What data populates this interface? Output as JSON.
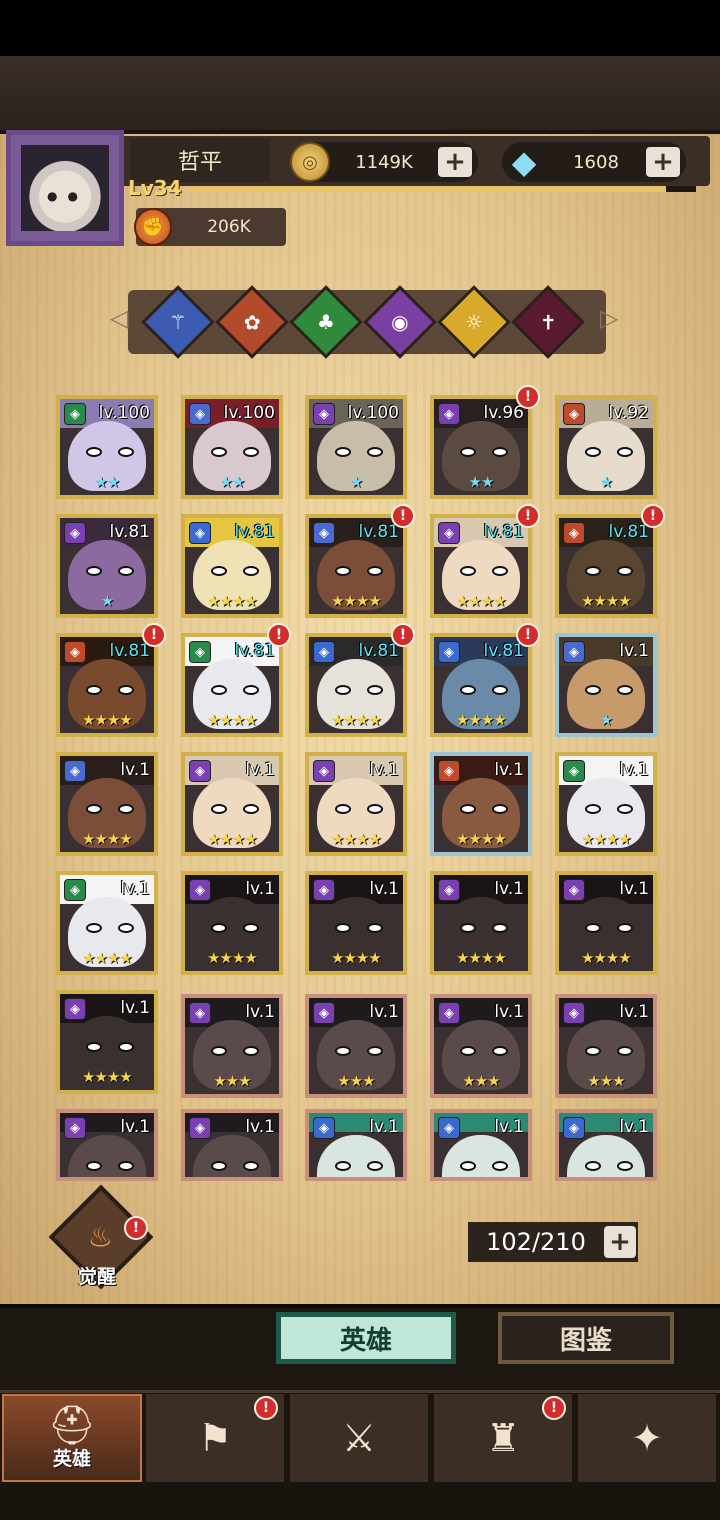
{
  "player": {
    "name": "哲平",
    "level_label": "Lv34",
    "xp_fraction": 0.94,
    "power": "206K"
  },
  "currency": {
    "gold": "1149K",
    "gems": "1608",
    "add_symbol": "+"
  },
  "filters": [
    {
      "icon": "staff-emblem-icon",
      "color": "#3d5bb0",
      "glyph": "⚚"
    },
    {
      "icon": "rose-emblem-icon",
      "color": "#b24a2c",
      "glyph": "✿"
    },
    {
      "icon": "clover-emblem-icon",
      "color": "#2f8a3c",
      "glyph": "♣"
    },
    {
      "icon": "eye-emblem-icon",
      "color": "#7a3fa0",
      "glyph": "◉"
    },
    {
      "icon": "sun-emblem-icon",
      "color": "#d8a92a",
      "glyph": "☼"
    },
    {
      "icon": "dagger-emblem-icon",
      "color": "#5a1a30",
      "glyph": "✝"
    }
  ],
  "heroes": [
    {
      "level": "lv.100",
      "stars": "★★",
      "class": "tank",
      "cyan": false,
      "blue_stars": true,
      "tier": "gold",
      "alert": false,
      "skin": "#cfc6e8",
      "hair": "#8a7bb0"
    },
    {
      "level": "lv.100",
      "stars": "★★",
      "class": "mage",
      "cyan": false,
      "blue_stars": true,
      "tier": "gold",
      "alert": false,
      "skin": "#d9c9cf",
      "hair": "#7a1f2a"
    },
    {
      "level": "lv.100",
      "stars": "★",
      "class": "support",
      "cyan": false,
      "blue_stars": true,
      "tier": "gold",
      "alert": false,
      "skin": "#c8bda8",
      "hair": "#6a6458"
    },
    {
      "level": "lv.96",
      "stars": "★★",
      "class": "assassin",
      "cyan": false,
      "blue_stars": true,
      "tier": "gold",
      "alert": true,
      "skin": "#5a4a40",
      "hair": "#2a2020"
    },
    {
      "level": "lv.92",
      "stars": "★",
      "class": "warrior",
      "cyan": false,
      "blue_stars": true,
      "tier": "gold",
      "alert": false,
      "skin": "#e6dccb",
      "hair": "#b9ad98"
    },
    {
      "level": "lv.81",
      "stars": "★",
      "class": "support",
      "cyan": false,
      "blue_stars": true,
      "tier": "gold",
      "alert": false,
      "skin": "#8a6aa0",
      "hair": "#3a2a3a"
    },
    {
      "level": "lv.81",
      "stars": "★★★★",
      "class": "ranger",
      "cyan": true,
      "blue_stars": false,
      "tier": "gold",
      "alert": false,
      "skin": "#efe2b4",
      "hair": "#e6c640"
    },
    {
      "level": "lv.81",
      "stars": "★★★★",
      "class": "mage",
      "cyan": true,
      "blue_stars": false,
      "tier": "gold",
      "alert": true,
      "skin": "#7a4e38",
      "hair": "#2a1e1a"
    },
    {
      "level": "lv.81",
      "stars": "★★★★",
      "class": "assassin",
      "cyan": true,
      "blue_stars": false,
      "tier": "gold",
      "alert": true,
      "skin": "#efd9c0",
      "hair": "#d8c8b0"
    },
    {
      "level": "lv.81",
      "stars": "★★★★",
      "class": "gunner",
      "cyan": true,
      "blue_stars": false,
      "tier": "gold",
      "alert": true,
      "skin": "#5a4630",
      "hair": "#2a2218"
    },
    {
      "level": "lv.81",
      "stars": "★★★★",
      "class": "warrior",
      "cyan": true,
      "blue_stars": false,
      "tier": "gold",
      "alert": true,
      "skin": "#7a4a2e",
      "hair": "#2a1a10"
    },
    {
      "level": "lv.81",
      "stars": "★★★★",
      "class": "tank",
      "cyan": true,
      "blue_stars": false,
      "tier": "gold",
      "alert": true,
      "skin": "#e8e8ef",
      "hair": "#f4f4f4"
    },
    {
      "level": "lv.81",
      "stars": "★★★★",
      "class": "ranger",
      "cyan": true,
      "blue_stars": false,
      "tier": "gold",
      "alert": true,
      "skin": "#e6e2da",
      "hair": "#2a2a2a"
    },
    {
      "level": "lv.81",
      "stars": "★★★★",
      "class": "ranger",
      "cyan": true,
      "blue_stars": false,
      "tier": "gold",
      "alert": true,
      "skin": "#6a8aa8",
      "hair": "#2a3a58"
    },
    {
      "level": "lv.1",
      "stars": "★",
      "class": "mage",
      "cyan": false,
      "blue_stars": true,
      "tier": "blue",
      "alert": false,
      "skin": "#c79a6a",
      "hair": "#4a3a2a"
    },
    {
      "level": "lv.1",
      "stars": "★★★★",
      "class": "mage",
      "cyan": false,
      "blue_stars": false,
      "tier": "gold",
      "alert": false,
      "skin": "#7a4e38",
      "hair": "#2a1e1a"
    },
    {
      "level": "lv.1",
      "stars": "★★★★",
      "class": "assassin",
      "cyan": false,
      "blue_stars": false,
      "tier": "gold",
      "alert": false,
      "skin": "#efd9c0",
      "hair": "#d8c8b0"
    },
    {
      "level": "lv.1",
      "stars": "★★★★",
      "class": "assassin",
      "cyan": false,
      "blue_stars": false,
      "tier": "gold",
      "alert": false,
      "skin": "#efd9c0",
      "hair": "#d8c8b0"
    },
    {
      "level": "lv.1",
      "stars": "★★★★",
      "class": "warrior",
      "cyan": false,
      "blue_stars": false,
      "tier": "blue",
      "alert": false,
      "skin": "#8a5a40",
      "hair": "#3a1a14"
    },
    {
      "level": "lv.1",
      "stars": "★★★★",
      "class": "tank",
      "cyan": false,
      "blue_stars": false,
      "tier": "gold",
      "alert": false,
      "skin": "#e8e8ef",
      "hair": "#f4f4f4"
    },
    {
      "level": "lv.1",
      "stars": "★★★★",
      "class": "tank",
      "cyan": false,
      "blue_stars": false,
      "tier": "gold",
      "alert": false,
      "skin": "#e8e8ef",
      "hair": "#f4f4f4"
    },
    {
      "level": "lv.1",
      "stars": "★★★★",
      "class": "rogue",
      "cyan": false,
      "blue_stars": false,
      "tier": "gold",
      "alert": false,
      "skin": "#3a3030",
      "hair": "#1a1414"
    },
    {
      "level": "lv.1",
      "stars": "★★★★",
      "class": "rogue",
      "cyan": false,
      "blue_stars": false,
      "tier": "gold",
      "alert": false,
      "skin": "#3a3030",
      "hair": "#1a1414"
    },
    {
      "level": "lv.1",
      "stars": "★★★★",
      "class": "rogue",
      "cyan": false,
      "blue_stars": false,
      "tier": "gold",
      "alert": false,
      "skin": "#3a3030",
      "hair": "#1a1414"
    },
    {
      "level": "lv.1",
      "stars": "★★★★",
      "class": "rogue",
      "cyan": false,
      "blue_stars": false,
      "tier": "gold",
      "alert": false,
      "skin": "#3a3030",
      "hair": "#1a1414"
    },
    {
      "level": "lv.1",
      "stars": "★★★★",
      "class": "rogue",
      "cyan": false,
      "blue_stars": false,
      "tier": "gold",
      "alert": false,
      "skin": "#3a3030",
      "hair": "#1a1414"
    },
    {
      "level": "lv.1",
      "stars": "★★★",
      "class": "assassin",
      "cyan": false,
      "blue_stars": false,
      "tier": "bronze",
      "alert": false,
      "skin": "#5a4a4a",
      "hair": "#1f1a1e"
    },
    {
      "level": "lv.1",
      "stars": "★★★",
      "class": "assassin",
      "cyan": false,
      "blue_stars": false,
      "tier": "bronze",
      "alert": false,
      "skin": "#5a4a4a",
      "hair": "#1f1a1e"
    },
    {
      "level": "lv.1",
      "stars": "★★★",
      "class": "assassin",
      "cyan": false,
      "blue_stars": false,
      "tier": "bronze",
      "alert": false,
      "skin": "#5a4a4a",
      "hair": "#1f1a1e"
    },
    {
      "level": "lv.1",
      "stars": "★★★",
      "class": "assassin",
      "cyan": false,
      "blue_stars": false,
      "tier": "bronze",
      "alert": false,
      "skin": "#5a4a4a",
      "hair": "#1f1a1e"
    },
    {
      "level": "lv.1",
      "stars": "",
      "class": "assassin",
      "cyan": false,
      "blue_stars": false,
      "tier": "bronze",
      "alert": false,
      "skin": "#5a4a4a",
      "hair": "#1f1a1e"
    },
    {
      "level": "lv.1",
      "stars": "",
      "class": "assassin",
      "cyan": false,
      "blue_stars": false,
      "tier": "bronze",
      "alert": false,
      "skin": "#5a4a4a",
      "hair": "#1f1a1e"
    },
    {
      "level": "lv.1",
      "stars": "",
      "class": "ranger",
      "cyan": false,
      "blue_stars": false,
      "tier": "bronze",
      "alert": false,
      "skin": "#d9e6df",
      "hair": "#2a8a74"
    },
    {
      "level": "lv.1",
      "stars": "",
      "class": "ranger",
      "cyan": false,
      "blue_stars": false,
      "tier": "bronze",
      "alert": false,
      "skin": "#d9e6df",
      "hair": "#2a8a74"
    },
    {
      "level": "lv.1",
      "stars": "",
      "class": "ranger",
      "cyan": false,
      "blue_stars": false,
      "tier": "bronze",
      "alert": false,
      "skin": "#d9e6df",
      "hair": "#2a8a74"
    }
  ],
  "class_colors": {
    "tank": "#2a8a4a",
    "mage": "#4a6ad0",
    "support": "#7a3fb0",
    "assassin": "#7a3fb0",
    "warrior": "#c04a2c",
    "ranger": "#3a6ad0",
    "gunner": "#c04a2c",
    "rogue": "#7a3fb0"
  },
  "awaken": {
    "label": "觉醒",
    "alert": "!"
  },
  "roster_count": "102/210",
  "tabs": {
    "heroes": "英雄",
    "codex": "图鉴"
  },
  "nav": [
    {
      "label": "英雄",
      "icon": "knight-helmet-icon",
      "glyph": "⛑",
      "alert": false,
      "active": true
    },
    {
      "label": "",
      "icon": "ship-flag-icon",
      "glyph": "⚑",
      "alert": true,
      "active": false
    },
    {
      "label": "",
      "icon": "crossed-swords-icon",
      "glyph": "⚔",
      "alert": false,
      "active": false
    },
    {
      "label": "",
      "icon": "castle-tower-icon",
      "glyph": "♜",
      "alert": true,
      "active": false
    },
    {
      "label": "",
      "icon": "guild-handshake-icon",
      "glyph": "✦",
      "alert": false,
      "active": false
    }
  ],
  "alert_glyph": "!"
}
